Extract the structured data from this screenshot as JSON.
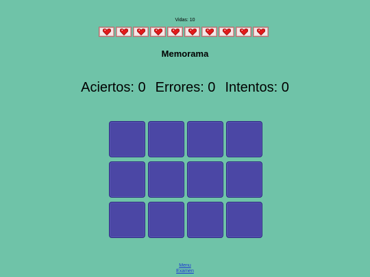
{
  "lives": {
    "label": "Vidas: 10",
    "count": 10,
    "heart_icon": "heart-icon",
    "heart_color": "#e11a1a"
  },
  "game": {
    "title": "Memorama"
  },
  "score": {
    "hits": "Aciertos: 0",
    "errors": "Errores: 0",
    "attempts": "Intentos: 0"
  },
  "board": {
    "rows": 3,
    "columns": 4,
    "card_color": "#4b47a5"
  },
  "links": {
    "menu": "Menu",
    "exam": "Examen"
  }
}
